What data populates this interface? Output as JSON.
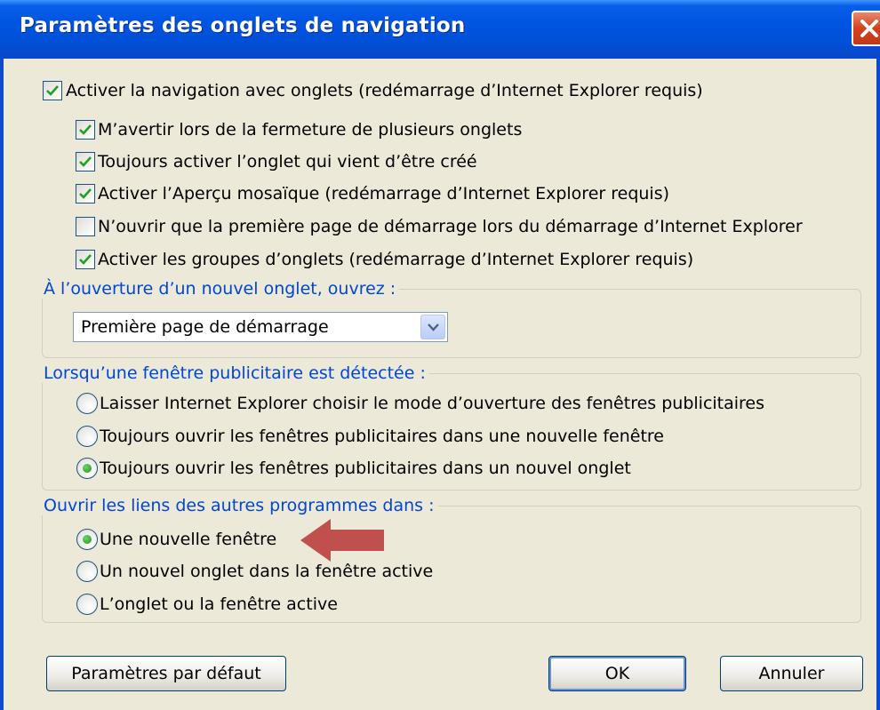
{
  "window": {
    "title": "Paramètres des onglets de navigation"
  },
  "main_checkbox": {
    "label": "Activer la navigation avec onglets (redémarrage d’Internet Explorer requis)",
    "checked": true
  },
  "sub_checkboxes": [
    {
      "label": "M’avertir lors de la fermeture de plusieurs onglets",
      "checked": true
    },
    {
      "label": "Toujours activer l’onglet qui vient d’être créé",
      "checked": true
    },
    {
      "label": "Activer l’Aperçu mosaïque (redémarrage d’Internet Explorer requis)",
      "checked": true
    },
    {
      "label": "N’ouvrir que la première page de démarrage lors du démarrage d’Internet Explorer",
      "checked": false
    },
    {
      "label": "Activer les groupes d’onglets (redémarrage d’Internet Explorer requis)",
      "checked": true
    }
  ],
  "new_tab_group": {
    "legend": "À l’ouverture d’un nouvel onglet, ouvrez :",
    "selected": "Première page de démarrage"
  },
  "popup_group": {
    "legend": "Lorsqu’une fenêtre publicitaire est détectée :",
    "options": [
      {
        "label": "Laisser Internet Explorer choisir le mode d’ouverture des fenêtres publicitaires",
        "selected": false
      },
      {
        "label": "Toujours ouvrir les fenêtres publicitaires dans une nouvelle fenêtre",
        "selected": false
      },
      {
        "label": "Toujours ouvrir les fenêtres publicitaires dans un nouvel onglet",
        "selected": true
      }
    ]
  },
  "links_group": {
    "legend": "Ouvrir les liens des autres programmes dans :",
    "options": [
      {
        "label": "Une nouvelle fenêtre",
        "selected": true
      },
      {
        "label": "Un nouvel onglet dans la fenêtre active",
        "selected": false
      },
      {
        "label": "L’onglet ou la fenêtre active",
        "selected": false
      }
    ]
  },
  "buttons": {
    "defaults": "Paramètres par défaut",
    "ok": "OK",
    "cancel": "Annuler"
  },
  "colors": {
    "title_bar": "#0055e3",
    "dialog_bg": "#ece9d8",
    "legend_text": "#0046d5",
    "annotation_arrow": "#c0504d",
    "checkmark": "#21a121"
  },
  "icons": {
    "close": "close-icon",
    "dropdown": "chevron-down-icon",
    "annotation": "arrow-left-icon"
  }
}
